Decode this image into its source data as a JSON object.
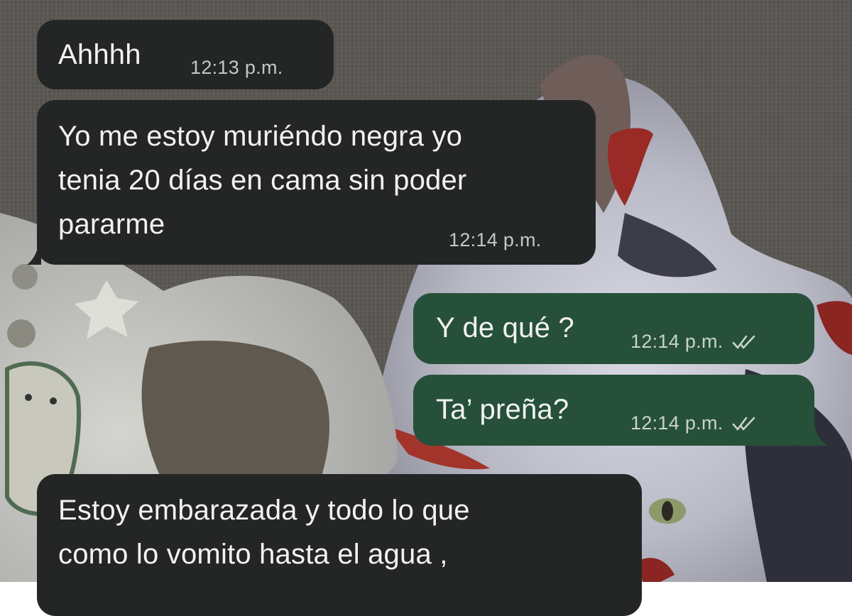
{
  "chat": {
    "messages": [
      {
        "direction": "incoming",
        "text": "Ahhhh",
        "time": "12:13 p.m."
      },
      {
        "direction": "incoming",
        "text": "Yo me estoy muriéndo negra yo\ntenia 20 días en cama sin poder\npararme",
        "time": "12:14 p.m."
      },
      {
        "direction": "outgoing",
        "text": "Y de qué ?",
        "time": "12:14 p.m.",
        "status": "read"
      },
      {
        "direction": "outgoing",
        "text": "Ta’ preña?",
        "time": "12:14 p.m.",
        "status": "read"
      },
      {
        "direction": "incoming",
        "text": "Estoy embarazada y todo lo que\ncomo lo vomito hasta el agua ,",
        "time": ""
      }
    ]
  },
  "theme": {
    "incoming_bubble": "#242626",
    "outgoing_bubble": "#26503a",
    "text": "#f2f2f2",
    "meta_text": "#c4c7c5",
    "read_tick_icon": "double-check-icon"
  }
}
